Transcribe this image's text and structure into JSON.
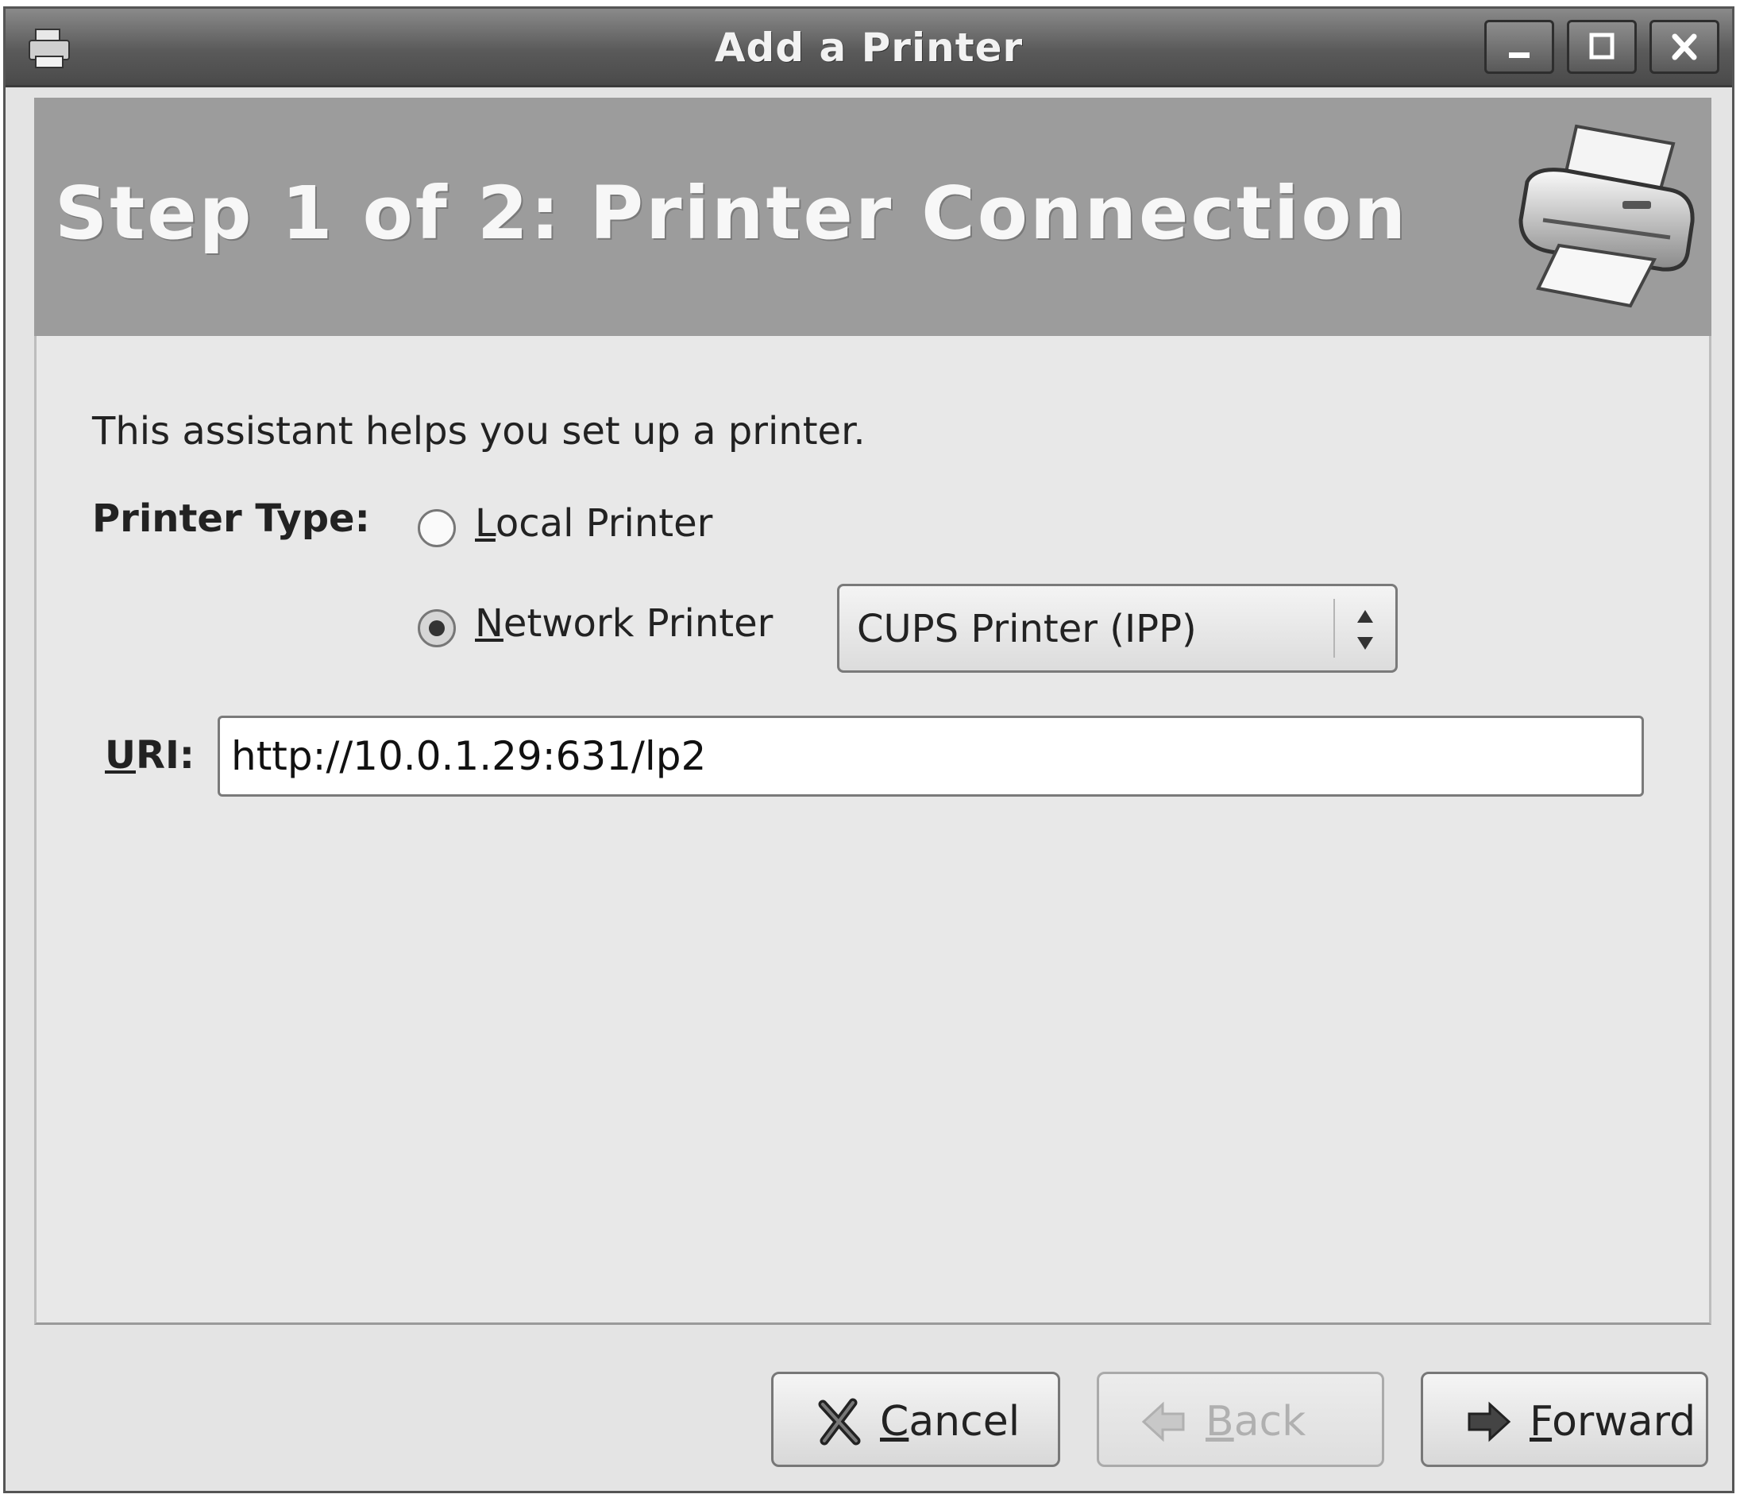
{
  "window": {
    "title": "Add a Printer"
  },
  "banner": {
    "title": "Step 1 of 2: Printer Connection",
    "icon": "printer-icon"
  },
  "content": {
    "intro": "This assistant helps you set up a printer.",
    "printer_type_label": "Printer Type:",
    "local_printer": {
      "mnemonic": "L",
      "rest": "ocal Printer",
      "selected": false
    },
    "network_printer": {
      "mnemonic": "N",
      "rest": "etwork Printer",
      "selected": true
    },
    "connection_type": {
      "selected": "CUPS Printer (IPP)"
    },
    "uri": {
      "mnemonic": "U",
      "rest": "RI:",
      "value": "http://10.0.1.29:631/lp2"
    }
  },
  "buttons": {
    "cancel": {
      "mnemonic": "C",
      "rest": "ancel",
      "enabled": true,
      "icon": "cancel-x-icon"
    },
    "back": {
      "mnemonic": "B",
      "rest": "ack",
      "enabled": false,
      "icon": "back-arrow-icon"
    },
    "forward": {
      "mnemonic": "F",
      "rest": "orward",
      "enabled": true,
      "icon": "forward-arrow-icon"
    }
  },
  "colors": {
    "banner_bg": "#9c9c9c",
    "titlebar": "#5a5a5a",
    "window_bg": "#e4e4e4"
  }
}
